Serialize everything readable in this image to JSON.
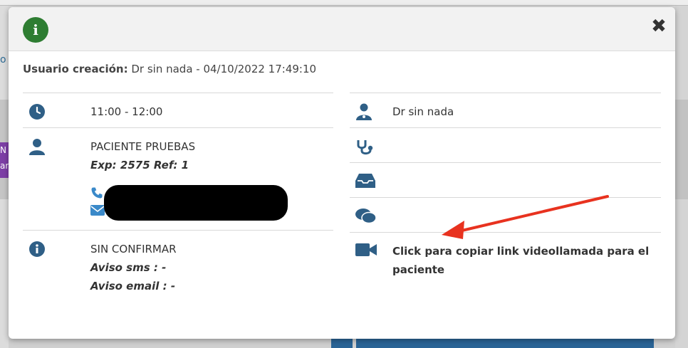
{
  "background": {
    "left_fragment": "o",
    "purple_fragment": "N\nara"
  },
  "modal": {
    "close_symbol": "✖",
    "info_symbol": "i",
    "created_label": "Usuario creación:",
    "created_value": "Dr sin nada - 04/10/2022 17:49:10",
    "left": {
      "time": "11:00 - 12:00",
      "patient_name": "PACIENTE PRUEBAS",
      "patient_exp": "Exp: 2575 Ref: 1",
      "status": "SIN CONFIRMAR",
      "aviso_sms": "Aviso sms : -",
      "aviso_email": "Aviso email : -"
    },
    "right": {
      "doctor": "Dr sin nada",
      "videocall_link_line1": "Click para copiar link videollamada para el",
      "videocall_link_line2": "paciente"
    }
  },
  "colors": {
    "accent": "#2a6496",
    "icon": "#2f5f86",
    "badge": "#2e7d32",
    "arrow": "#e8321f"
  }
}
